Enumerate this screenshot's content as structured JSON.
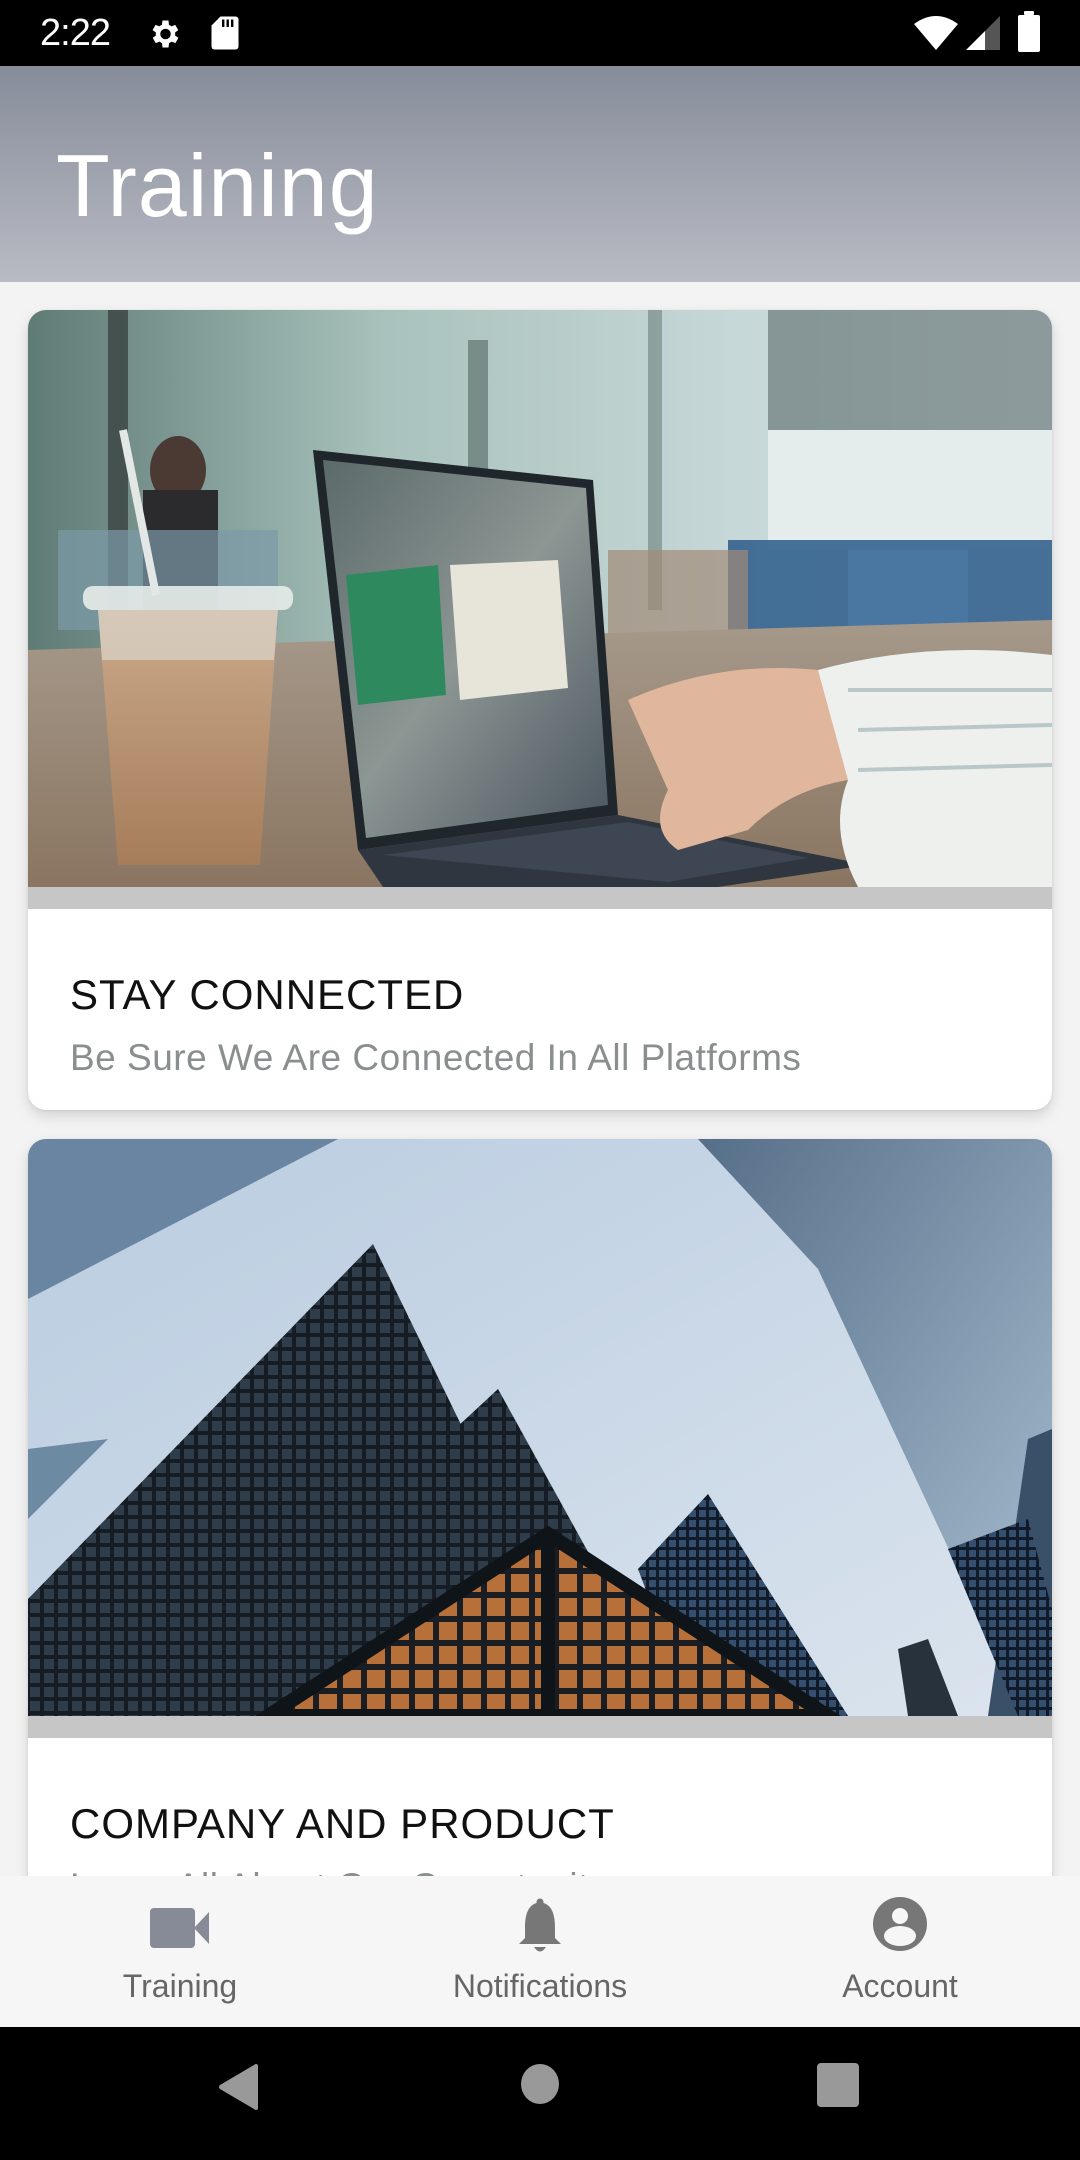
{
  "status_bar": {
    "time": "2:22",
    "icons": [
      "gear-icon",
      "sd-card-icon",
      "wifi-icon",
      "signal-icon",
      "battery-icon"
    ]
  },
  "header": {
    "title": "Training"
  },
  "cards": [
    {
      "title": "STAY CONNECTED",
      "subtitle": "Be Sure We Are Connected In All Platforms",
      "image": "laptop-cafe-photo"
    },
    {
      "title": "COMPANY AND PRODUCT",
      "subtitle": "Learn All About Our Opportunity",
      "image": "skyscrapers-photo"
    }
  ],
  "bottom_nav": {
    "items": [
      {
        "label": "Training",
        "icon": "video-camera-icon",
        "active": true
      },
      {
        "label": "Notifications",
        "icon": "bell-icon",
        "active": false
      },
      {
        "label": "Account",
        "icon": "account-circle-icon",
        "active": false
      }
    ]
  },
  "system_nav": {
    "buttons": [
      "back",
      "home",
      "recents"
    ]
  },
  "colors": {
    "header_top": "#878c9a",
    "header_bottom": "#b9bbc4",
    "active_nav_icon": "#868b97",
    "inactive_nav_icon": "#757575",
    "card_band": "#c6c6c6",
    "subtitle": "#8a8e8e"
  }
}
